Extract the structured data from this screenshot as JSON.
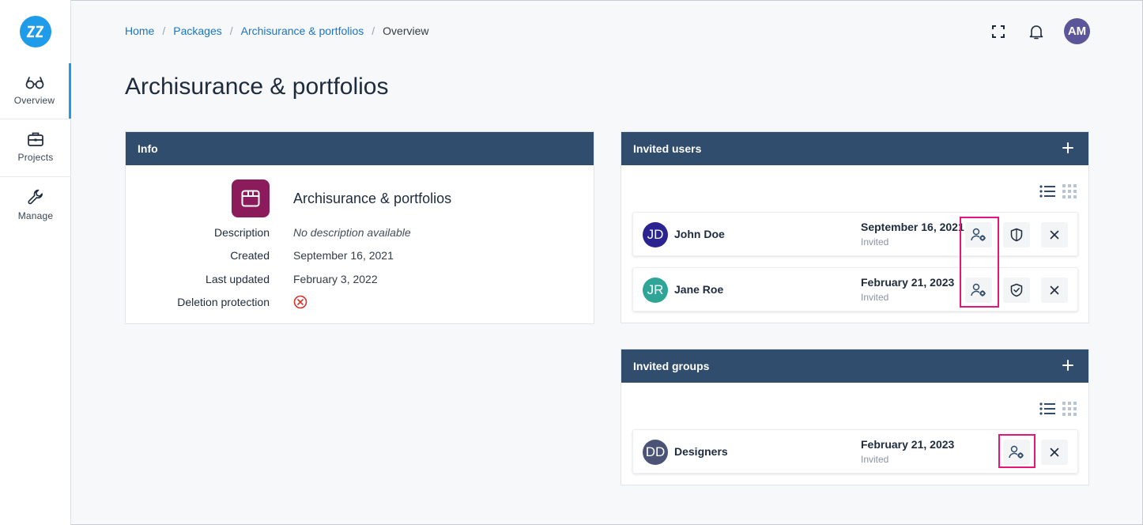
{
  "sidebar": {
    "logo_text": "ZZ",
    "items": [
      {
        "label": "Overview",
        "icon": "glasses-icon"
      },
      {
        "label": "Projects",
        "icon": "briefcase-icon"
      },
      {
        "label": "Manage",
        "icon": "wrench-icon"
      }
    ]
  },
  "breadcrumb": {
    "items": [
      "Home",
      "Packages",
      "Archisurance & portfolios"
    ],
    "current": "Overview"
  },
  "header": {
    "avatar_initials": "AM"
  },
  "page": {
    "title": "Archisurance & portfolios"
  },
  "info": {
    "title": "Info",
    "package_name": "Archisurance & portfolios",
    "rows": [
      {
        "key": "Description",
        "value": "No description available"
      },
      {
        "key": "Created",
        "value": "September 16, 2021"
      },
      {
        "key": "Last updated",
        "value": "February 3, 2022"
      },
      {
        "key": "Deletion protection",
        "value": ""
      }
    ]
  },
  "invited_users": {
    "title": "Invited users",
    "items": [
      {
        "initials": "JD",
        "name": "John Doe",
        "date": "September 16, 2021",
        "status": "Invited",
        "color": "#2a2390"
      },
      {
        "initials": "JR",
        "name": "Jane Roe",
        "date": "February 21, 2023",
        "status": "Invited",
        "color": "#2ea597"
      }
    ]
  },
  "invited_groups": {
    "title": "Invited groups",
    "items": [
      {
        "initials": "DD",
        "name": "Designers",
        "date": "February 21, 2023",
        "status": "Invited",
        "color": "#4b5476"
      }
    ]
  },
  "colors": {
    "accent": "#1e9be9",
    "header_bar": "#304d6e",
    "highlight": "#e6157a",
    "package": "#8c1b5b"
  }
}
